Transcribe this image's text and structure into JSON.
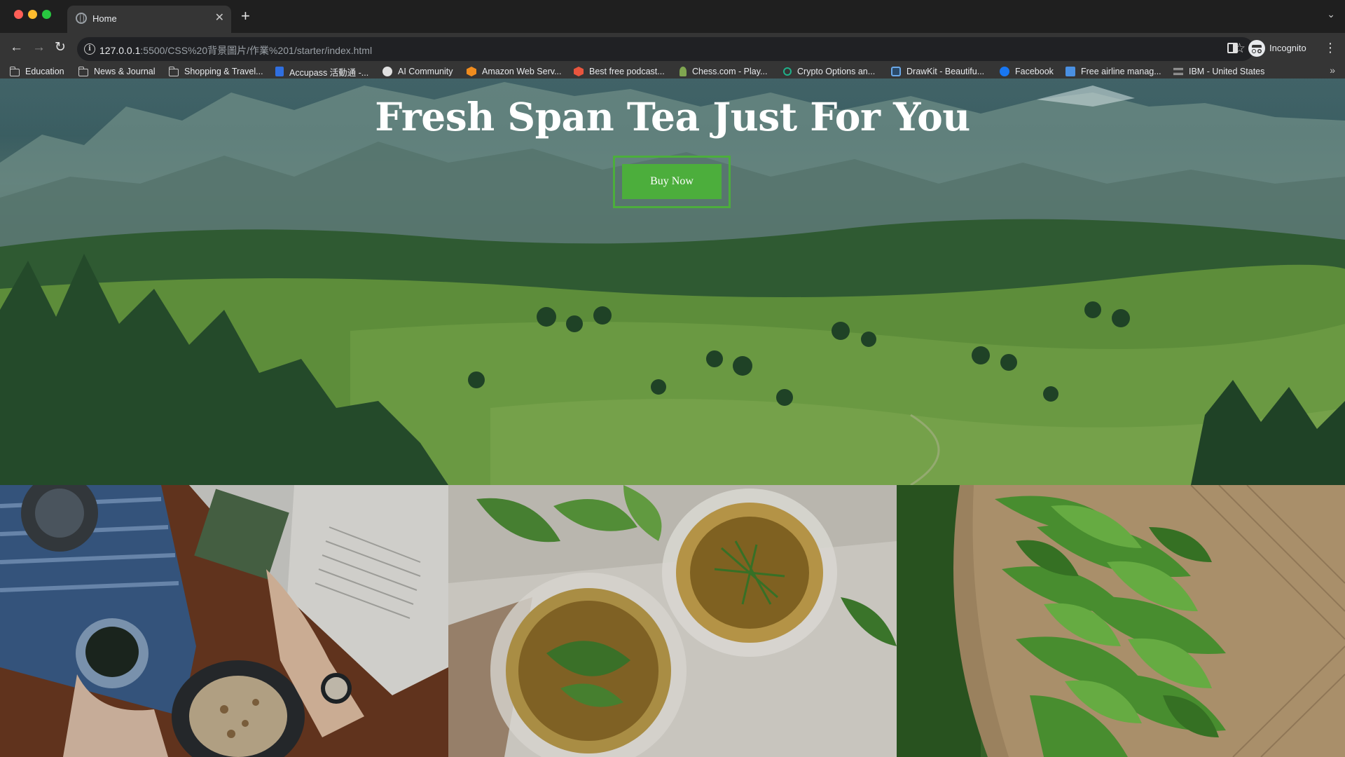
{
  "browser": {
    "tab": {
      "title": "Home",
      "favicon": "globe-icon"
    },
    "address": {
      "host": "127.0.0.1",
      "rest": ":5500/CSS%20背景圖片/作業%201/starter/index.html"
    },
    "profile_label": "Incognito",
    "bookmarks": [
      {
        "label": "Education",
        "icon": "folder-icon"
      },
      {
        "label": "News & Journal",
        "icon": "folder-icon"
      },
      {
        "label": "Shopping & Travel...",
        "icon": "folder-icon"
      },
      {
        "label": "Accupass 活動通 -...",
        "icon": "accupass-icon",
        "color": "#2f6fe0"
      },
      {
        "label": "AI Community",
        "icon": "ai-community-icon",
        "color": "#e0e0e0"
      },
      {
        "label": "Amazon Web Serv...",
        "icon": "aws-icon",
        "color": "#f08c1e"
      },
      {
        "label": "Best free podcast...",
        "icon": "podcast-icon",
        "color": "#e8553e"
      },
      {
        "label": "Chess.com - Play...",
        "icon": "chess-icon",
        "color": "#7fa650"
      },
      {
        "label": "Crypto Options an...",
        "icon": "crypto-icon",
        "color": "#1fb08a"
      },
      {
        "label": "DrawKit - Beautifu...",
        "icon": "drawkit-icon",
        "color": "#6aa8e8"
      },
      {
        "label": "Facebook",
        "icon": "facebook-icon",
        "color": "#1877f2"
      },
      {
        "label": "Free airline manag...",
        "icon": "airline-icon",
        "color": "#4a90e2"
      },
      {
        "label": "IBM - United States",
        "icon": "ibm-icon",
        "color": "#c8c8c8"
      }
    ]
  },
  "page": {
    "hero_title": "Fresh Span Tea Just For You",
    "buy_button": "Buy Now",
    "accent_color": "#4cae3c",
    "gallery": [
      {
        "name": "tea-and-book-photo"
      },
      {
        "name": "herbal-tea-glasses-photo"
      },
      {
        "name": "green-tea-leaves-basket-photo"
      }
    ]
  }
}
